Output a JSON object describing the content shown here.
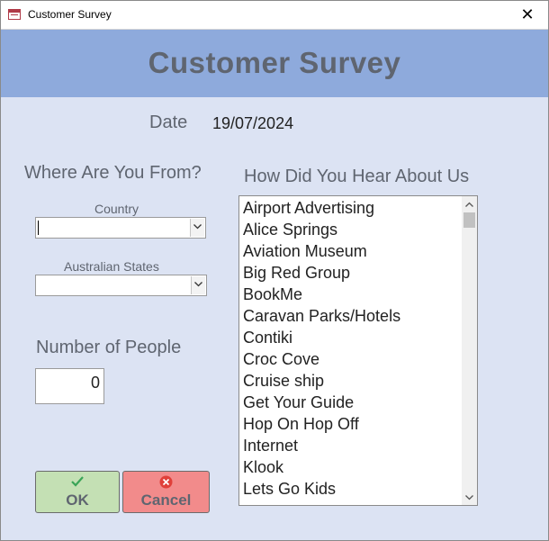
{
  "window": {
    "title": "Customer Survey",
    "close_symbol": "✕"
  },
  "header": {
    "title": "Customer Survey"
  },
  "date": {
    "label": "Date",
    "value": "19/07/2024"
  },
  "where": {
    "title": "Where Are You From?",
    "country_label": "Country",
    "country_value": "",
    "states_label": "Australian States",
    "states_value": ""
  },
  "people": {
    "label": "Number of People",
    "value": "0"
  },
  "buttons": {
    "ok_label": "OK",
    "cancel_label": "Cancel"
  },
  "hear": {
    "title": "How Did You Hear About Us",
    "items": [
      "Airport Advertising",
      "Alice Springs",
      "Aviation Museum",
      "Big Red Group",
      "BookMe",
      "Caravan Parks/Hotels",
      "Contiki",
      "Croc Cove",
      "Cruise ship",
      "Get Your Guide",
      "Hop On Hop Off",
      "Internet",
      "Klook",
      "Lets Go Kids"
    ]
  },
  "colors": {
    "header_band": "#8eaadc",
    "form_bg": "#dce3f3",
    "ok_bg": "#c4e0b4",
    "cancel_bg": "#f28b8b",
    "ok_check": "#3aa457",
    "cancel_x": "#e0403a"
  }
}
